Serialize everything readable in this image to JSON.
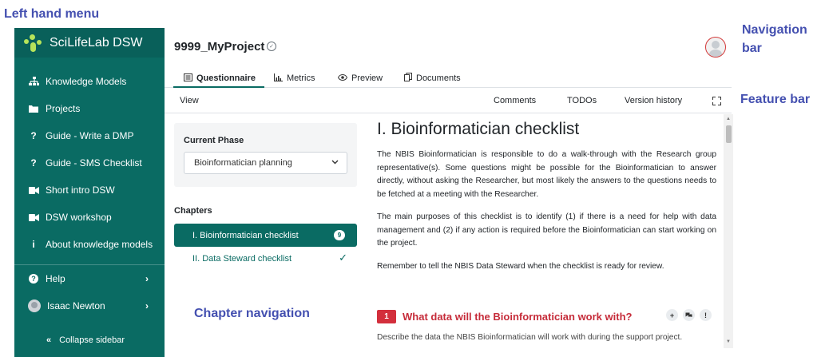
{
  "annotations": {
    "left_menu": "Left hand menu",
    "navigation_bar": "Navigation bar",
    "feature_bar": "Feature bar",
    "chapter_navigation": "Chapter navigation"
  },
  "sidebar": {
    "brand": "SciLifeLab DSW",
    "items": [
      {
        "label": "Knowledge Models",
        "icon": "sitemap-icon"
      },
      {
        "label": "Projects",
        "icon": "folder-icon"
      },
      {
        "label": "Guide - Write a DMP",
        "icon": "question-icon"
      },
      {
        "label": "Guide - SMS Checklist",
        "icon": "question-icon"
      },
      {
        "label": "Short intro DSW",
        "icon": "video-icon"
      },
      {
        "label": "DSW workshop",
        "icon": "video-icon"
      },
      {
        "label": "About knowledge models",
        "icon": "info-icon"
      }
    ],
    "help_label": "Help",
    "user_name": "Isaac Newton",
    "collapse_label": "Collapse sidebar"
  },
  "header": {
    "project_title": "9999_MyProject"
  },
  "tabs": [
    {
      "label": "Questionnaire",
      "icon": "list-icon",
      "active": true
    },
    {
      "label": "Metrics",
      "icon": "chart-icon",
      "active": false
    },
    {
      "label": "Preview",
      "icon": "eye-icon",
      "active": false
    },
    {
      "label": "Documents",
      "icon": "copy-icon",
      "active": false
    }
  ],
  "feature_bar": {
    "view": "View",
    "comments": "Comments",
    "todos": "TODOs",
    "version_history": "Version history"
  },
  "phase": {
    "label": "Current Phase",
    "selected": "Bioinformatician planning"
  },
  "chapters": {
    "label": "Chapters",
    "items": [
      {
        "label": "I. Bioinformatician checklist",
        "badge": "9"
      },
      {
        "label": "II. Data Steward checklist"
      }
    ]
  },
  "content": {
    "title": "I. Bioinformatician checklist",
    "paragraphs": [
      "The NBIS Bioinformatician is responsible to do a walk-through with the Research group representative(s). Some questions might be possible for the Bioinformatician to answer directly, without asking the Researcher, but most likely the answers to the questions needs to be fetched at a meeting with the Researcher.",
      "The main purposes of this checklist is to identify (1) if there is a need for help with data management and (2) if any action is required before the Bioinformatician can start working on the project.",
      "Remember to tell the NBIS Data Steward when the checklist is ready for review."
    ],
    "question": {
      "number": "1",
      "title": "What data will the Bioinformatician work with?",
      "description": "Describe the data the NBIS Bioinformatician will work with during the support project."
    }
  },
  "colors": {
    "sidebar": "#0a6b63",
    "accent": "#0a6b63",
    "question": "#c62c3a",
    "annotation": "#4450b0"
  }
}
